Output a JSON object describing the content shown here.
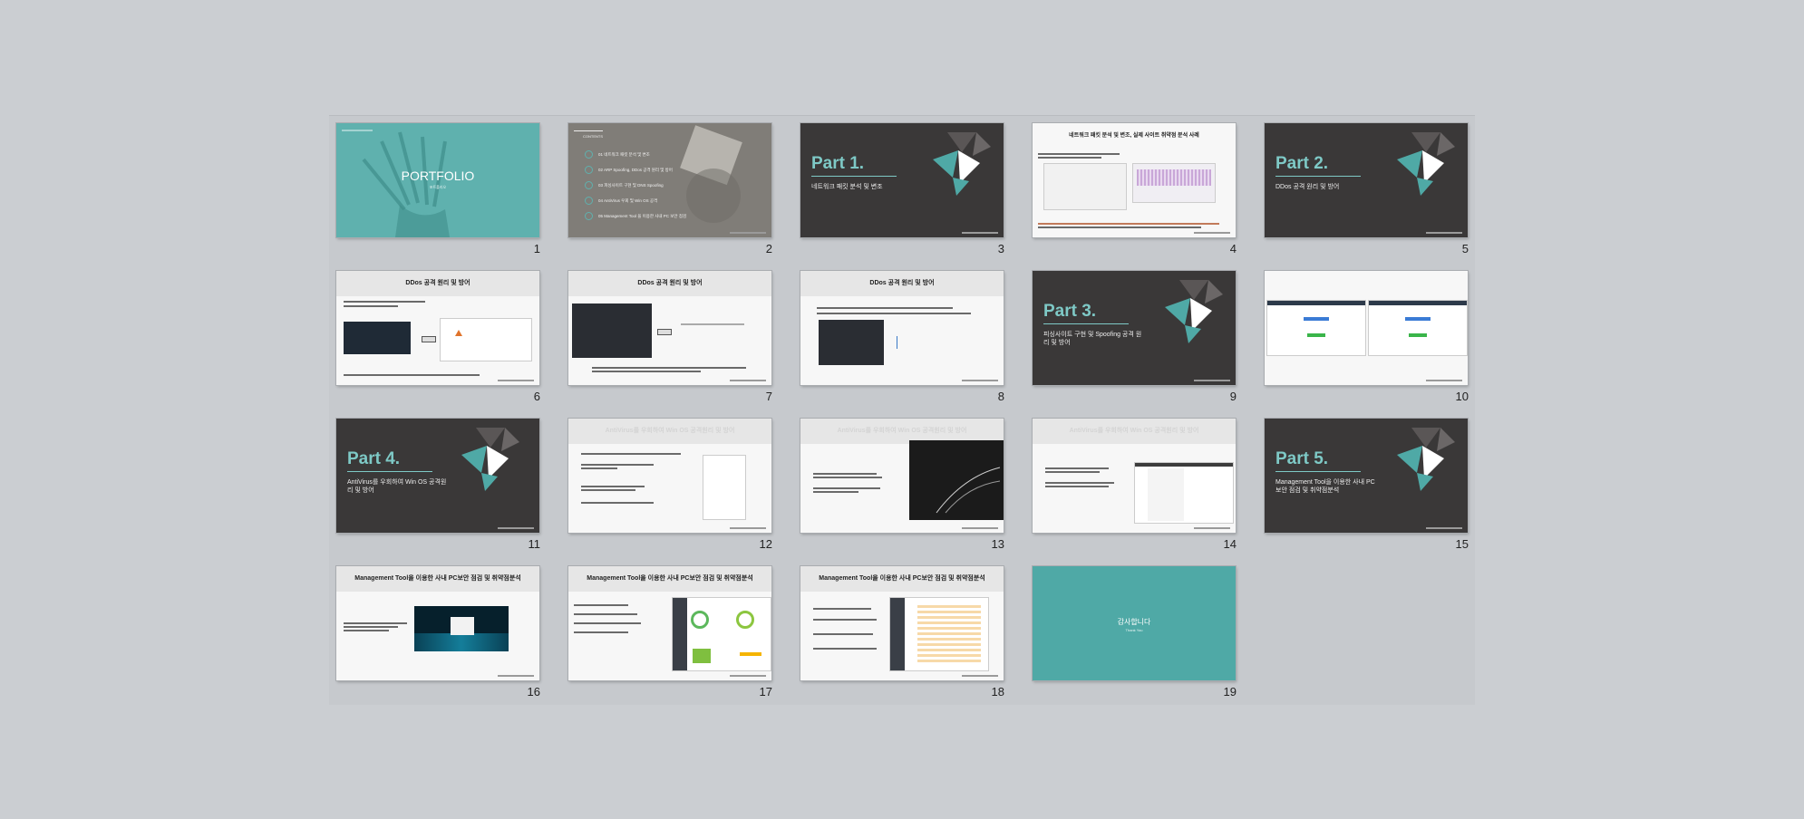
{
  "slides": [
    {
      "num": "1",
      "title": "PORTFOLIO",
      "subtitle": "포트폴리오"
    },
    {
      "num": "2",
      "header": "CONTENTS",
      "items": [
        "01 네트워크 패킷 분석 및 변조",
        "02 ARP Spoofing, DDos 공격 원리 및 방어",
        "03 피싱사이트 구현 및 DNS Spoofing",
        "04 AntiVirus 우회 및 Win OS 공격",
        "05 Management Tool 을 이용한 사내 PC 보안 점검"
      ]
    },
    {
      "num": "3",
      "title": "Part 1.",
      "subtitle": "네트워크 패킷 분석 및 변조"
    },
    {
      "num": "4",
      "header": "네트워크 패킷 분석 및 변조, 실제 사이트 취약점 분석 사례"
    },
    {
      "num": "5",
      "title": "Part 2.",
      "subtitle": "DDos 공격 원리 및 방어"
    },
    {
      "num": "6",
      "header": "DDos 공격 원리 및 방어"
    },
    {
      "num": "7",
      "header": "DDos 공격 원리 및 방어"
    },
    {
      "num": "8",
      "header": "DDos 공격 원리 및 방어"
    },
    {
      "num": "9",
      "title": "Part 3.",
      "subtitle": "피싱사이트 구현 및 Spoofing 공격 원리 및 방어"
    },
    {
      "num": "10"
    },
    {
      "num": "11",
      "title": "Part 4.",
      "subtitle": "AntiVirus를 우회하여 Win OS 공격원리 및 방어"
    },
    {
      "num": "12",
      "header": "AntiVirus를 우회하여 Win OS 공격원리 및 방어"
    },
    {
      "num": "13",
      "header": "AntiVirus를 우회하여 Win OS 공격원리 및 방어"
    },
    {
      "num": "14",
      "header": "AntiVirus를 우회하여 Win OS 공격원리 및 방어"
    },
    {
      "num": "15",
      "title": "Part 5.",
      "subtitle": "Management Tool을 이용한 사내 PC보안 점검 및 취약점분석"
    },
    {
      "num": "16",
      "header": "Management Tool을 이용한 사내 PC보안 점검 및 취약점분석"
    },
    {
      "num": "17",
      "header": "Management Tool을 이용한 사내 PC보안 점검 및 취약점분석"
    },
    {
      "num": "18",
      "header": "Management Tool을 이용한 사내 PC보안 점검 및 취약점분석"
    },
    {
      "num": "19",
      "title": "감사합니다",
      "subtitle": "Thank You"
    }
  ]
}
